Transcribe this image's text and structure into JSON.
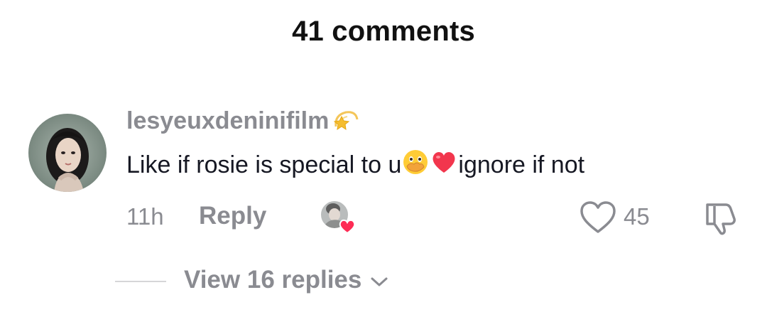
{
  "header": {
    "title": "41 comments"
  },
  "comment": {
    "username": "lesyeuxdeninifilm",
    "username_emoji": "dizzy-emoji",
    "text_part1": "Like if rosie is special to u",
    "text_emojis": [
      "face-with-open-eyes-and-hand-over-mouth-emoji",
      "red-heart-emoji"
    ],
    "text_part2": "ignore if not",
    "time": "11h",
    "reply_label": "Reply",
    "like_count": "45",
    "creator_liked": true,
    "view_replies_label": "View 16 replies"
  },
  "colors": {
    "text_primary": "#161823",
    "text_secondary": "#8a8b91",
    "heart_badge": "#fe2c55",
    "divider": "#d6d6d8"
  }
}
